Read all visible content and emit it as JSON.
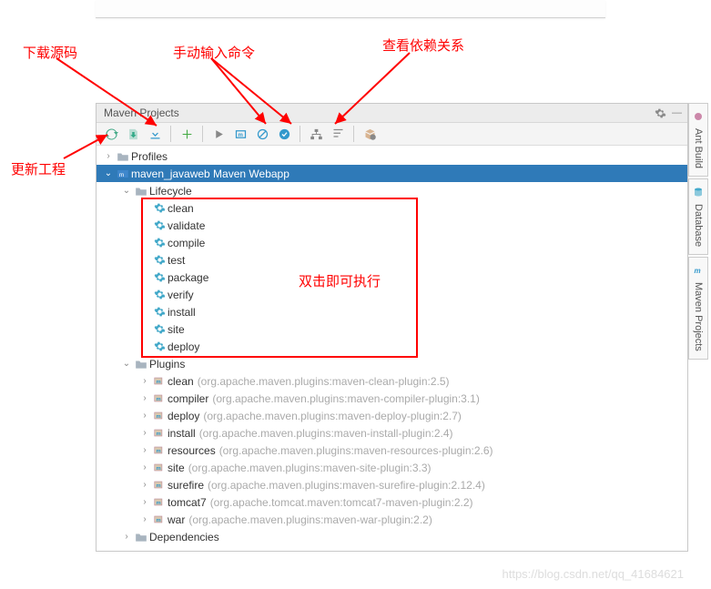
{
  "annotations": {
    "download_src": "下载源码",
    "manual_cmd": "手动输入命令",
    "view_deps": "查看依赖关系",
    "refresh_proj": "更新工程",
    "dbl_click_exec": "双击即可执行"
  },
  "panel": {
    "title": "Maven Projects"
  },
  "tree": {
    "profiles": "Profiles",
    "project": "maven_javaweb Maven Webapp",
    "lifecycle": "Lifecycle",
    "lifecycle_items": [
      "clean",
      "validate",
      "compile",
      "test",
      "package",
      "verify",
      "install",
      "site",
      "deploy"
    ],
    "plugins": "Plugins",
    "plugin_items": [
      {
        "name": "clean",
        "coords": "(org.apache.maven.plugins:maven-clean-plugin:2.5)"
      },
      {
        "name": "compiler",
        "coords": "(org.apache.maven.plugins:maven-compiler-plugin:3.1)"
      },
      {
        "name": "deploy",
        "coords": "(org.apache.maven.plugins:maven-deploy-plugin:2.7)"
      },
      {
        "name": "install",
        "coords": "(org.apache.maven.plugins:maven-install-plugin:2.4)"
      },
      {
        "name": "resources",
        "coords": "(org.apache.maven.plugins:maven-resources-plugin:2.6)"
      },
      {
        "name": "site",
        "coords": "(org.apache.maven.plugins:maven-site-plugin:3.3)"
      },
      {
        "name": "surefire",
        "coords": "(org.apache.maven.plugins:maven-surefire-plugin:2.12.4)"
      },
      {
        "name": "tomcat7",
        "coords": "(org.apache.tomcat.maven:tomcat7-maven-plugin:2.2)"
      },
      {
        "name": "war",
        "coords": "(org.apache.maven.plugins:maven-war-plugin:2.2)"
      }
    ],
    "dependencies": "Dependencies"
  },
  "side_tabs": {
    "ant": "Ant Build",
    "database": "Database",
    "maven": "Maven Projects"
  },
  "watermark": "https://blog.csdn.net/qq_41684621"
}
